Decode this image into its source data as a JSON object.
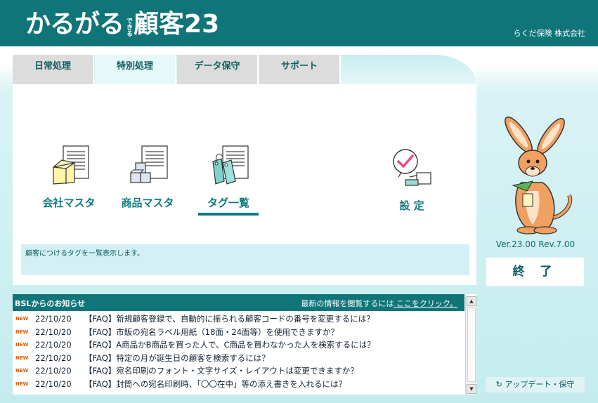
{
  "header": {
    "logo_main": "かるがる",
    "logo_small": "できる",
    "logo_name": "顧客23",
    "company": "らくだ保険 株式会社"
  },
  "tabs": [
    {
      "label": "日常処理"
    },
    {
      "label": "特別処理"
    },
    {
      "label": "データ保守"
    },
    {
      "label": "サポート"
    }
  ],
  "functions": [
    {
      "label": "会社マスタ",
      "icon": "company-master-icon"
    },
    {
      "label": "商品マスタ",
      "icon": "product-master-icon"
    },
    {
      "label": "タグ一覧",
      "icon": "tag-list-icon",
      "selected": true
    },
    {
      "label": "設 定",
      "icon": "settings-icon"
    }
  ],
  "description": "顧客につけるタグを一覧表示します。",
  "version": "Ver.23.00 Rev.7.00",
  "exit_label": "終 了",
  "update_label": "アップデート・保守",
  "news": {
    "title": "BSLからのお知らせ",
    "info_prefix": "最新の情報を閲覧するには",
    "info_link": " ここをクリック。",
    "items": [
      {
        "badge": "NEW",
        "date": "22/10/20",
        "text": "【FAQ】新規顧客登録で、自動的に振られる顧客コードの番号を変更するには？"
      },
      {
        "badge": "NEW",
        "date": "22/10/20",
        "text": "【FAQ】市販の宛名ラベル用紙（18面・24面等）を使用できますか？"
      },
      {
        "badge": "NEW",
        "date": "22/10/20",
        "text": "【FAQ】A商品かB商品を買った人で、C商品を買わなかった人を検索するには？"
      },
      {
        "badge": "NEW",
        "date": "22/10/20",
        "text": "【FAQ】特定の月が誕生日の顧客を検索するには？"
      },
      {
        "badge": "NEW",
        "date": "22/10/20",
        "text": "【FAQ】宛名印刷のフォント・文字サイズ・レイアウトは変更できますか？"
      },
      {
        "badge": "NEW",
        "date": "22/10/20",
        "text": "【FAQ】封筒への宛名印刷時、「〇〇在中」等の添え書きを入れるには？"
      }
    ]
  },
  "colors": {
    "brand": "#0f7579",
    "accent_text": "#127a80",
    "new_badge": "#e65a00",
    "kangaroo": "#f0a060"
  }
}
